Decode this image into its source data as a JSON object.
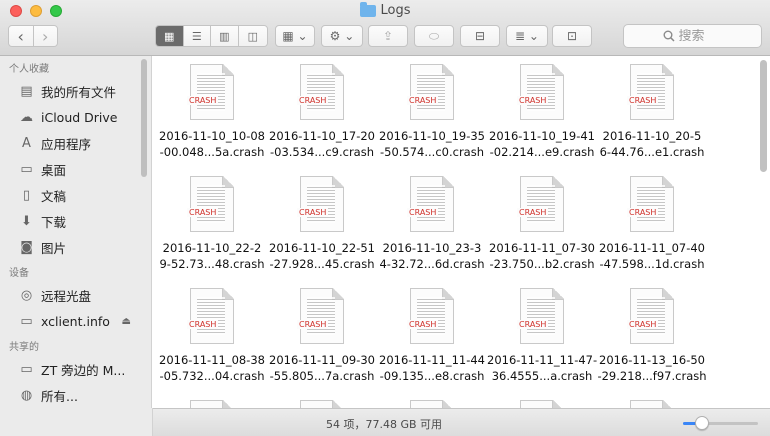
{
  "window": {
    "title": "Logs"
  },
  "toolbar": {
    "back_glyph": "‹",
    "forward_glyph": "›",
    "view_modes": [
      {
        "name": "icon-view",
        "glyph": "▦",
        "active": true
      },
      {
        "name": "list-view",
        "glyph": "☰",
        "active": false
      },
      {
        "name": "column-view",
        "glyph": "▥",
        "active": false
      },
      {
        "name": "coverflow-view",
        "glyph": "◫",
        "active": false
      }
    ],
    "arrange_glyph": "▦ ⌄",
    "action_glyph": "⚙ ⌄",
    "share_glyph": "⇪",
    "tag_glyph": "⬭",
    "connect_glyph": "⊟",
    "sort_glyph": "≣ ⌄",
    "new_folder_glyph": "⊡",
    "search_placeholder": "搜索"
  },
  "sidebar": {
    "sections": [
      {
        "label": "个人收藏",
        "items": [
          {
            "label": "我的所有文件",
            "icon": "all-files-icon",
            "glyph": "▤"
          },
          {
            "label": "iCloud Drive",
            "icon": "cloud-icon",
            "glyph": "☁"
          },
          {
            "label": "应用程序",
            "icon": "applications-icon",
            "glyph": "A"
          },
          {
            "label": "桌面",
            "icon": "desktop-icon",
            "glyph": "▭"
          },
          {
            "label": "文稿",
            "icon": "documents-icon",
            "glyph": "▯"
          },
          {
            "label": "下载",
            "icon": "downloads-icon",
            "glyph": "⬇"
          },
          {
            "label": "图片",
            "icon": "pictures-icon",
            "glyph": "◙"
          }
        ]
      },
      {
        "label": "设备",
        "items": [
          {
            "label": "远程光盘",
            "icon": "remote-disc-icon",
            "glyph": "◎"
          },
          {
            "label": "xclient.info",
            "icon": "disk-icon",
            "glyph": "▭",
            "eject": "⏏"
          }
        ]
      },
      {
        "label": "共享的",
        "items": [
          {
            "label": "ZT 旁边的 M...",
            "icon": "computer-icon",
            "glyph": "▭"
          },
          {
            "label": "所有...",
            "icon": "network-icon",
            "glyph": "◍"
          }
        ]
      }
    ]
  },
  "files": [
    {
      "line1": "2016-11-10_10-08",
      "line2": "-00.048...5a.crash"
    },
    {
      "line1": "2016-11-10_17-20",
      "line2": "-03.534...c9.crash"
    },
    {
      "line1": "2016-11-10_19-35",
      "line2": "-50.574...c0.crash"
    },
    {
      "line1": "2016-11-10_19-41",
      "line2": "-02.214...e9.crash"
    },
    {
      "line1": "2016-11-10_20-5",
      "line2": "6-44.76...e1.crash"
    },
    {
      "line1": "2016-11-10_22-2",
      "line2": "9-52.73...48.crash"
    },
    {
      "line1": "2016-11-10_22-51",
      "line2": "-27.928...45.crash"
    },
    {
      "line1": "2016-11-10_23-3",
      "line2": "4-32.72...6d.crash"
    },
    {
      "line1": "2016-11-11_07-30",
      "line2": "-23.750...b2.crash"
    },
    {
      "line1": "2016-11-11_07-40",
      "line2": "-47.598...1d.crash"
    },
    {
      "line1": "2016-11-11_08-38",
      "line2": "-05.732...04.crash"
    },
    {
      "line1": "2016-11-11_09-30",
      "line2": "-55.805...7a.crash"
    },
    {
      "line1": "2016-11-11_11-44",
      "line2": "-09.135...e8.crash"
    },
    {
      "line1": "2016-11-11_11-47-",
      "line2": "36.4555...a.crash"
    },
    {
      "line1": "2016-11-13_16-50",
      "line2": "-29.218...f97.crash"
    }
  ],
  "file_tag": "CRASH",
  "status": {
    "text": "54 项，77.48 GB 可用"
  },
  "zoom_level": 0.25,
  "colors": {
    "accent": "#3a86f7",
    "crash_tag": "#d0302a",
    "folder": "#6fb4ec"
  }
}
